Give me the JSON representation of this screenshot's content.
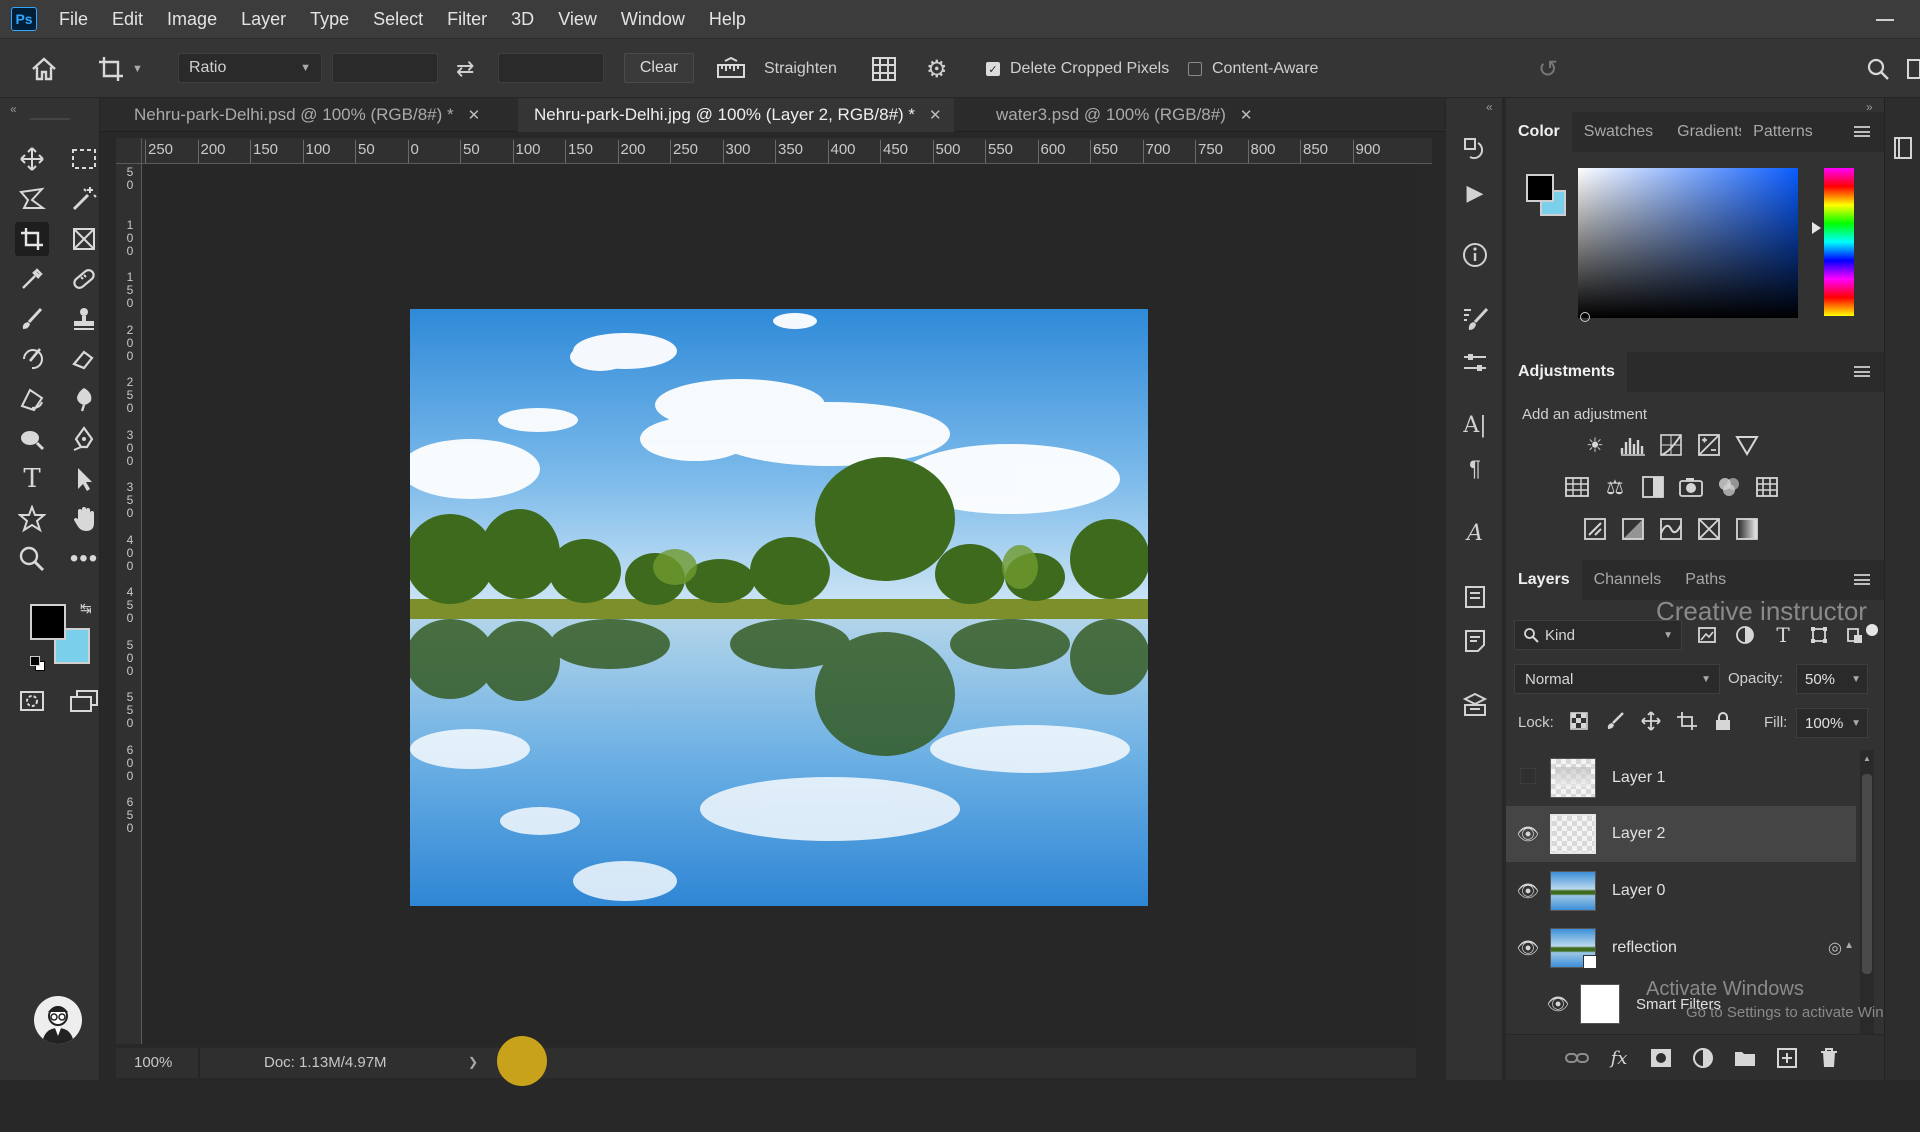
{
  "menubar": {
    "logo": "Ps",
    "items": [
      "File",
      "Edit",
      "Image",
      "Layer",
      "Type",
      "Select",
      "Filter",
      "3D",
      "View",
      "Window",
      "Help"
    ]
  },
  "options": {
    "ratio_label": "Ratio",
    "clear_label": "Clear",
    "straighten_label": "Straighten",
    "delete_cropped_label": "Delete Cropped Pixels",
    "delete_cropped_checked": true,
    "content_aware_label": "Content-Aware",
    "content_aware_checked": false
  },
  "tabs": [
    {
      "label": "Nehru-park-Delhi.psd @ 100% (RGB/8#) *",
      "active": false
    },
    {
      "label": "Nehru-park-Delhi.jpg @ 100% (Layer 2, RGB/8#) *",
      "active": true
    },
    {
      "label": "water3.psd @ 100% (RGB/8#)",
      "active": false
    }
  ],
  "ruler": {
    "h_ticks": [
      "250",
      "200",
      "150",
      "100",
      "50",
      "0",
      "50",
      "100",
      "150",
      "200",
      "250",
      "300",
      "350",
      "400",
      "450",
      "500",
      "550",
      "600",
      "650",
      "700",
      "750",
      "800",
      "850",
      "900"
    ],
    "v_ticks": [
      "5\n0",
      "1\n0\n0",
      "1\n5\n0",
      "2\n0\n0",
      "2\n5\n0",
      "3\n0\n0",
      "3\n5\n0",
      "4\n0\n0",
      "4\n5\n0",
      "5\n0\n0",
      "5\n5\n0",
      "6\n0\n0",
      "6\n5\n0"
    ]
  },
  "status": {
    "zoom": "100%",
    "doc": "Doc: 1.13M/4.97M",
    "arrow": "❯"
  },
  "color_panel": {
    "tabs": [
      "Color",
      "Swatches",
      "Gradients",
      "Patterns"
    ],
    "foreground": "#000000",
    "background": "#7ad0ea"
  },
  "adjustments": {
    "title": "Adjustments",
    "subtitle": "Add an adjustment"
  },
  "layers_panel": {
    "tabs": [
      "Layers",
      "Channels",
      "Paths"
    ],
    "kind_label": "Kind",
    "blend_mode": "Normal",
    "opacity_label": "Opacity:",
    "opacity_value": "50%",
    "lock_label": "Lock:",
    "fill_label": "Fill:",
    "fill_value": "100%",
    "layers": [
      {
        "name": "Layer 1",
        "visible": false,
        "selected": false
      },
      {
        "name": "Layer 2",
        "visible": true,
        "selected": true
      },
      {
        "name": "Layer 0",
        "visible": true,
        "selected": false
      },
      {
        "name": "reflection",
        "visible": true,
        "selected": false
      }
    ],
    "smart_filters_label": "Smart Filters"
  },
  "overlays": {
    "watermark": "Creative instructor",
    "activate_title": "Activate Windows",
    "activate_sub": "Go to Settings to activate Windo"
  }
}
